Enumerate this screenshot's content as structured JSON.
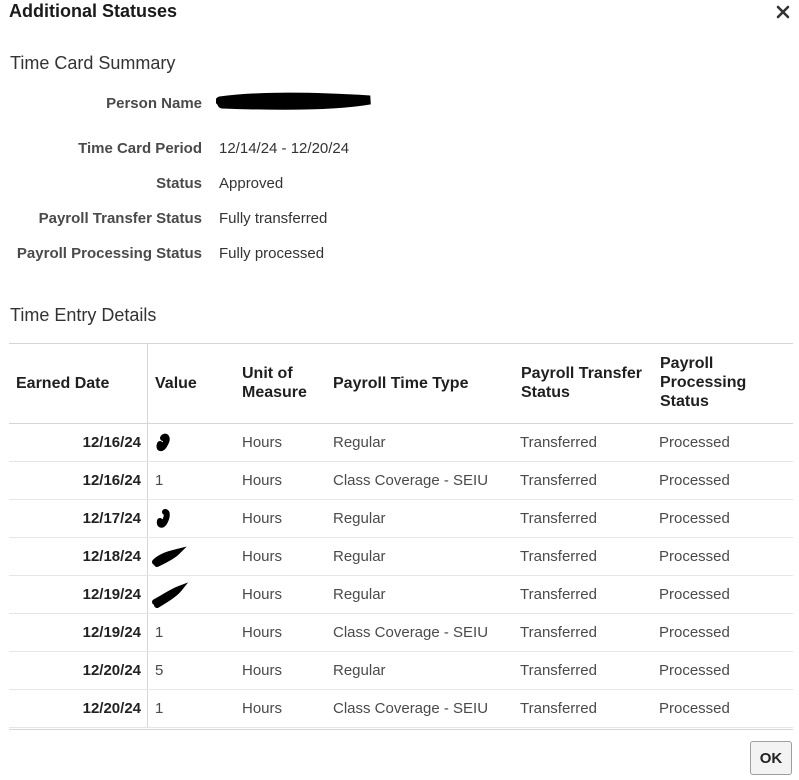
{
  "dialog": {
    "title": "Additional Statuses",
    "ok_label": "OK"
  },
  "summary": {
    "heading": "Time Card Summary",
    "fields": [
      {
        "label": "Person Name",
        "value": ""
      },
      {
        "label": "Time Card Period",
        "value": "12/14/24 - 12/20/24"
      },
      {
        "label": "Status",
        "value": "Approved"
      },
      {
        "label": "Payroll Transfer Status",
        "value": "Fully transferred"
      },
      {
        "label": "Payroll Processing Status",
        "value": "Fully processed"
      }
    ]
  },
  "details": {
    "heading": "Time Entry Details",
    "columns": [
      {
        "line1": "Earned Date",
        "line2": "",
        "line3": ""
      },
      {
        "line1": "Value",
        "line2": "",
        "line3": ""
      },
      {
        "line1": "Unit of",
        "line2": "Measure",
        "line3": ""
      },
      {
        "line1": "Payroll Time Type",
        "line2": "",
        "line3": ""
      },
      {
        "line1": "Payroll Transfer",
        "line2": "Status",
        "line3": ""
      },
      {
        "line1": "Payroll",
        "line2": "Processing",
        "line3": "Status"
      }
    ],
    "rows": [
      {
        "date": "12/16/24",
        "value": "",
        "uom": "Hours",
        "type": "Regular",
        "transfer": "Transferred",
        "processing": "Processed"
      },
      {
        "date": "12/16/24",
        "value": "1",
        "uom": "Hours",
        "type": "Class Coverage - SEIU",
        "transfer": "Transferred",
        "processing": "Processed"
      },
      {
        "date": "12/17/24",
        "value": "",
        "uom": "Hours",
        "type": "Regular",
        "transfer": "Transferred",
        "processing": "Processed"
      },
      {
        "date": "12/18/24",
        "value": "",
        "uom": "Hours",
        "type": "Regular",
        "transfer": "Transferred",
        "processing": "Processed"
      },
      {
        "date": "12/19/24",
        "value": "",
        "uom": "Hours",
        "type": "Regular",
        "transfer": "Transferred",
        "processing": "Processed"
      },
      {
        "date": "12/19/24",
        "value": "1",
        "uom": "Hours",
        "type": "Class Coverage - SEIU",
        "transfer": "Transferred",
        "processing": "Processed"
      },
      {
        "date": "12/20/24",
        "value": "5",
        "uom": "Hours",
        "type": "Regular",
        "transfer": "Transferred",
        "processing": "Processed"
      },
      {
        "date": "12/20/24",
        "value": "1",
        "uom": "Hours",
        "type": "Class Coverage - SEIU",
        "transfer": "Transferred",
        "processing": "Processed"
      }
    ]
  },
  "icons": {
    "close": "close-icon",
    "redaction": "redaction-scribble"
  }
}
